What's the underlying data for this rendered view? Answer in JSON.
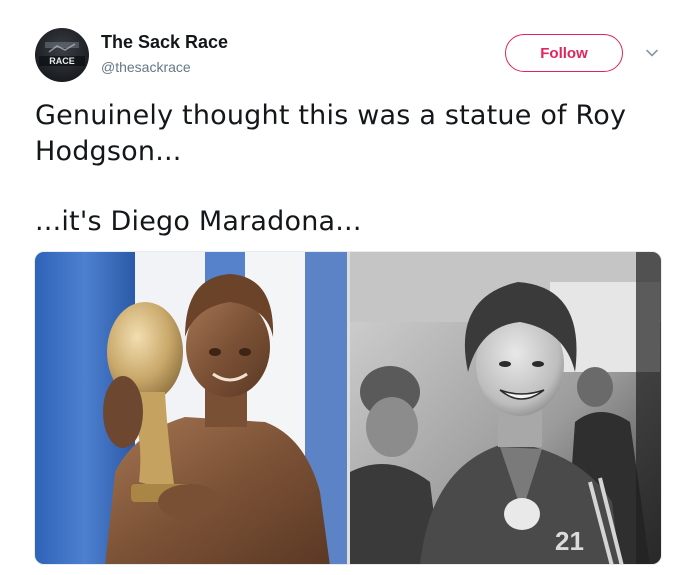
{
  "account": {
    "display_name": "The Sack Race",
    "handle": "@thesackrace",
    "avatar_text": "RACE"
  },
  "actions": {
    "follow_label": "Follow"
  },
  "tweet": {
    "line1": "Genuinely thought this was a statue of Roy Hodgson...",
    "line2": "...it's Diego Maradona..."
  },
  "media": {
    "left_photo": "bronze-statue-with-trophy",
    "right_photo": "black-and-white-smiling-player",
    "jersey_number": "21"
  },
  "colors": {
    "follow_accent": "#e0245e",
    "handle_gray": "#657786",
    "text_dark": "#14171a"
  }
}
